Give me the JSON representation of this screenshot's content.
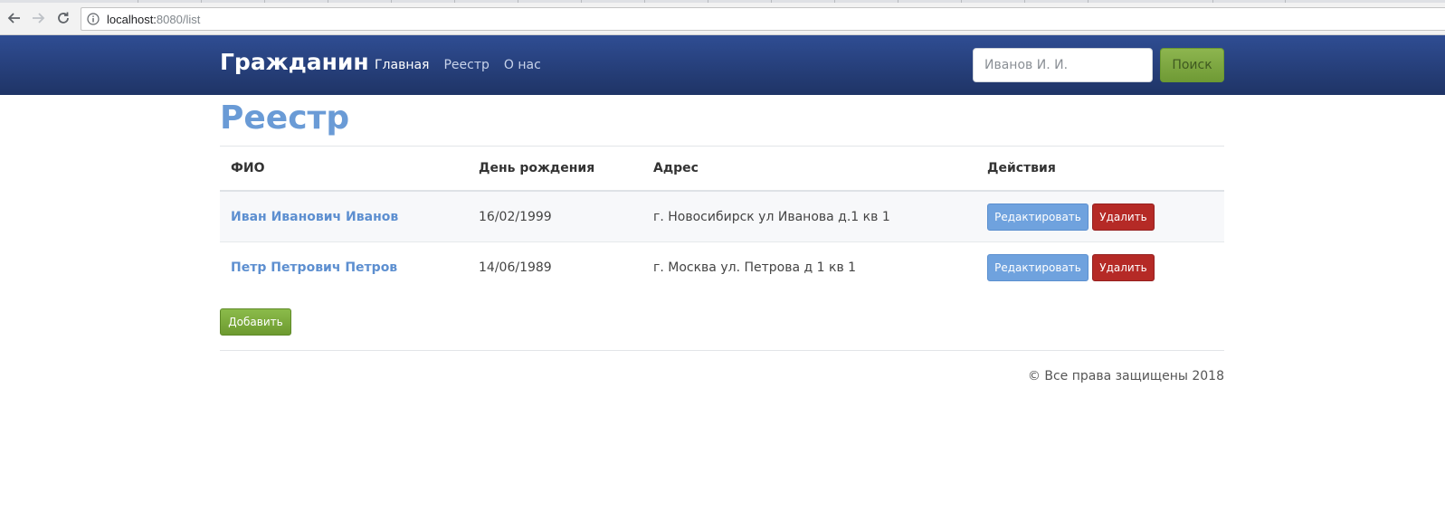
{
  "browser": {
    "url_host": "localhost:",
    "url_rest": "8080/list"
  },
  "navbar": {
    "brand": "Гражданин",
    "links": [
      "Главная",
      "Реестр",
      "О нас"
    ],
    "search_placeholder": "Иванов И. И.",
    "search_button": "Поиск"
  },
  "page": {
    "title": "Реестр"
  },
  "table": {
    "headers": [
      "ФИО",
      "День рождения",
      "Адрес",
      "Действия"
    ],
    "rows": [
      {
        "name": "Иван Иванович Иванов",
        "birthday": "16/02/1999",
        "address": "г. Новосибирск ул Иванова д.1 кв 1",
        "edit": "Редактировать",
        "delete": "Удалить"
      },
      {
        "name": "Петр Петрович Петров",
        "birthday": "14/06/1989",
        "address": "г. Москва ул. Петрова д 1 кв 1",
        "edit": "Редактировать",
        "delete": "Удалить"
      }
    ]
  },
  "add_button": "Добавить",
  "footer": "© Все права защищены 2018",
  "colors": {
    "navbar": "#2a4583",
    "title": "#6a9bd6",
    "edit_button": "#6fa2de",
    "delete_button": "#b52a26",
    "add_button": "#7ba83e"
  }
}
